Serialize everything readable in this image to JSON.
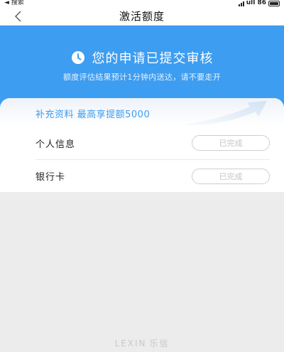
{
  "status_bar": {
    "back_label": "◄ 搜索",
    "carrier": "ull 86"
  },
  "nav": {
    "title": "激活额度"
  },
  "banner": {
    "title": "您的申请已提交审核",
    "subtitle": "额度评估结果预计1分钟内送达，请不要走开"
  },
  "card": {
    "title": "补充资料 最高享提额5000",
    "rows": [
      {
        "label": "个人信息",
        "status": "已完成"
      },
      {
        "label": "银行卡",
        "status": "已完成"
      }
    ]
  },
  "footer": {
    "brand_latin": "LEXIN",
    "brand_cn": "乐信"
  },
  "colors": {
    "accent": "#3d9df0",
    "background": "#ececed",
    "button_border": "#cfcfcf"
  }
}
